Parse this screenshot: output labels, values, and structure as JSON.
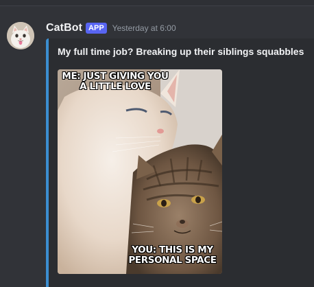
{
  "message": {
    "author": "CatBot",
    "badge": "APP",
    "timestamp": "Yesterday at 6:00"
  },
  "embed": {
    "title": "My full time job? Breaking up their siblings squabbles",
    "accent_color": "#3b8ed0",
    "image": {
      "top_caption": [
        "ME: JUST GIVING YOU",
        "A LITTLE LOVE"
      ],
      "bottom_caption": [
        "YOU: THIS IS MY",
        "PERSONAL SPACE"
      ]
    }
  },
  "colors": {
    "background": "#313338",
    "embed_background": "#2b2d31",
    "badge": "#5865f2",
    "username": "#f2f3f5",
    "timestamp": "#949ba4"
  }
}
